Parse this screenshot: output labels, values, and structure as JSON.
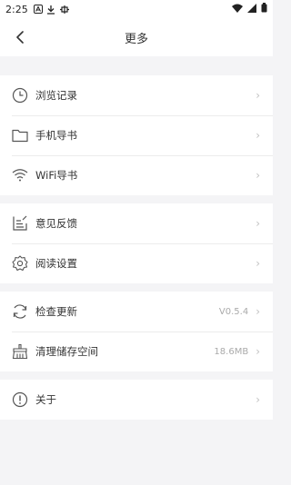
{
  "status": {
    "time": "2:25"
  },
  "header": {
    "title": "更多"
  },
  "groups": [
    {
      "items": [
        {
          "label": "浏览记录",
          "icon": "clock-icon"
        },
        {
          "label": "手机导书",
          "icon": "folder-icon"
        },
        {
          "label": "WiFi导书",
          "icon": "wifi-icon"
        }
      ]
    },
    {
      "items": [
        {
          "label": "意见反馈",
          "icon": "feedback-icon"
        },
        {
          "label": "阅读设置",
          "icon": "gear-icon"
        }
      ]
    },
    {
      "items": [
        {
          "label": "检查更新",
          "icon": "refresh-icon",
          "value": "V0.5.4"
        },
        {
          "label": "清理储存空间",
          "icon": "broom-icon",
          "value": "18.6MB"
        }
      ]
    },
    {
      "items": [
        {
          "label": "关于",
          "icon": "info-icon"
        }
      ]
    }
  ]
}
